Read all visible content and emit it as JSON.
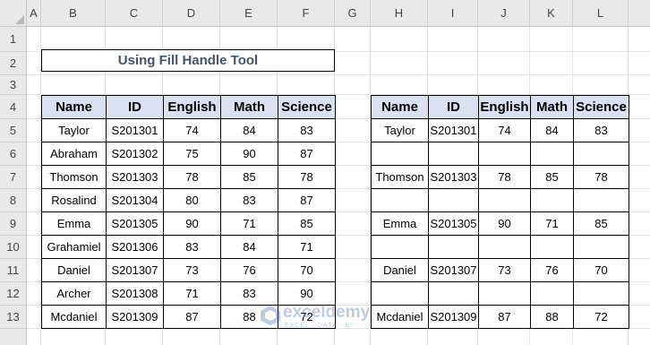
{
  "sheet": {
    "columns": [
      "A",
      "B",
      "C",
      "D",
      "E",
      "F",
      "G",
      "H",
      "I",
      "J",
      "K",
      "L"
    ],
    "rows": [
      "1",
      "2",
      "3",
      "4",
      "5",
      "6",
      "7",
      "8",
      "9",
      "10",
      "11",
      "12",
      "13"
    ]
  },
  "title": "Using Fill Handle Tool",
  "left_table": {
    "headers": [
      "Name",
      "ID",
      "English",
      "Math",
      "Science"
    ],
    "rows": [
      [
        "Taylor",
        "S201301",
        "74",
        "84",
        "83"
      ],
      [
        "Abraham",
        "S201302",
        "75",
        "90",
        "87"
      ],
      [
        "Thomson",
        "S201303",
        "78",
        "85",
        "78"
      ],
      [
        "Rosalind",
        "S201304",
        "80",
        "83",
        "87"
      ],
      [
        "Emma",
        "S201305",
        "90",
        "71",
        "85"
      ],
      [
        "Grahamiel",
        "S201306",
        "83",
        "84",
        "71"
      ],
      [
        "Daniel",
        "S201307",
        "73",
        "76",
        "70"
      ],
      [
        "Archer",
        "S201308",
        "71",
        "83",
        "90"
      ],
      [
        "Mcdaniel",
        "S201309",
        "87",
        "88",
        "72"
      ]
    ]
  },
  "right_table": {
    "headers": [
      "Name",
      "ID",
      "English",
      "Math",
      "Science"
    ],
    "rows": [
      [
        "Taylor",
        "S201301",
        "74",
        "84",
        "83"
      ],
      [
        "",
        "",
        "",
        "",
        ""
      ],
      [
        "Thomson",
        "S201303",
        "78",
        "85",
        "78"
      ],
      [
        "",
        "",
        "",
        "",
        ""
      ],
      [
        "Emma",
        "S201305",
        "90",
        "71",
        "85"
      ],
      [
        "",
        "",
        "",
        "",
        ""
      ],
      [
        "Daniel",
        "S201307",
        "73",
        "76",
        "70"
      ],
      [
        "",
        "",
        "",
        "",
        ""
      ],
      [
        "Mcdaniel",
        "S201309",
        "87",
        "88",
        "72"
      ]
    ]
  },
  "watermark": {
    "name": "exceldemy",
    "tagline": "EXCEL · DATA · BI"
  }
}
